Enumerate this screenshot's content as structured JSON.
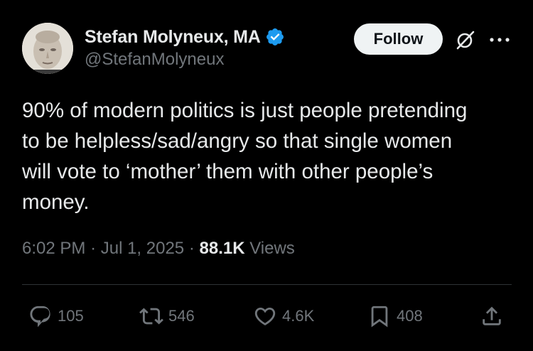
{
  "author": {
    "display_name": "Stefan Molyneux, MA",
    "handle": "@StefanMolyneux",
    "verified": true,
    "verified_color": "#1d9bf0"
  },
  "follow_button": {
    "label": "Follow"
  },
  "tweet": {
    "lines": [
      "90% of modern politics is just people pretending",
      "to be helpless/sad/angry so that single women",
      "will vote to ‘mother’ them with other people’s",
      "money."
    ]
  },
  "meta": {
    "time": "6:02 PM",
    "separator": "·",
    "date": "Jul 1, 2025",
    "views_count": "88.1K",
    "views_label": "Views"
  },
  "actions": {
    "replies": "105",
    "reposts": "546",
    "likes": "4.6K",
    "bookmarks": "408"
  },
  "icons": {
    "reply": "reply-icon",
    "repost": "repost-icon",
    "like": "heart-icon",
    "bookmark": "bookmark-icon",
    "share": "share-icon",
    "grok": "grok-icon",
    "more": "more-icon"
  },
  "colors": {
    "background": "#000000",
    "primary_text": "#e7e9ea",
    "secondary_text": "#71767b",
    "divider": "#2f3336",
    "follow_bg": "#eff3f4"
  }
}
